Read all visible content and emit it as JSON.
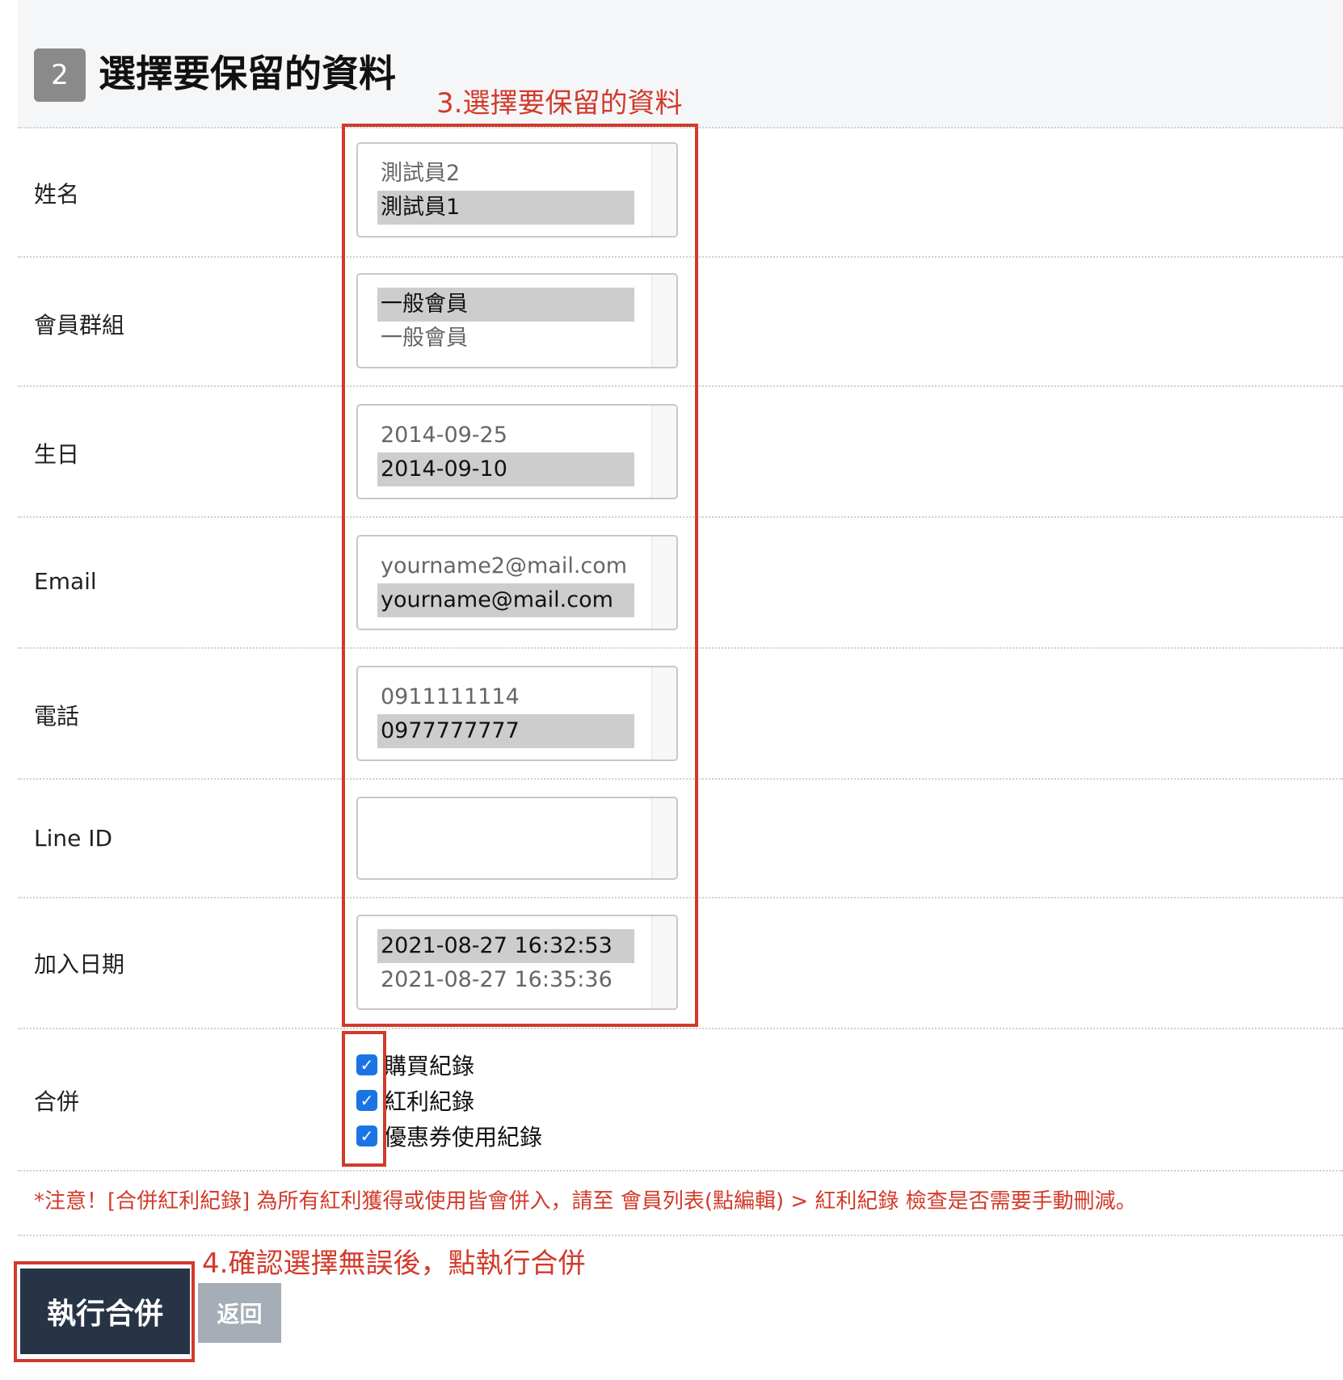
{
  "header": {
    "step_number": "2",
    "title": "選擇要保留的資料"
  },
  "annotations": {
    "step3": "3.選擇要保留的資料",
    "step4": "4.確認選擇無誤後，點執行合併"
  },
  "fields": [
    {
      "label": "姓名",
      "options": [
        {
          "text": "測試員2",
          "selected": false
        },
        {
          "text": "測試員1",
          "selected": true
        }
      ]
    },
    {
      "label": "會員群組",
      "options": [
        {
          "text": "一般會員",
          "selected": true
        },
        {
          "text": "一般會員",
          "selected": false
        }
      ]
    },
    {
      "label": "生日",
      "options": [
        {
          "text": "2014-09-25",
          "selected": false
        },
        {
          "text": "2014-09-10",
          "selected": true
        }
      ]
    },
    {
      "label": "Email",
      "options": [
        {
          "text": "yourname2@mail.com",
          "selected": false
        },
        {
          "text": "yourname@mail.com",
          "selected": true
        }
      ]
    },
    {
      "label": "電話",
      "options": [
        {
          "text": "0911111114",
          "selected": false
        },
        {
          "text": "0977777777",
          "selected": true
        }
      ]
    },
    {
      "label": "Line ID",
      "options": []
    },
    {
      "label": "加入日期",
      "options": [
        {
          "text": "2021-08-27 16:32:53",
          "selected": true
        },
        {
          "text": "2021-08-27 16:35:36",
          "selected": false
        }
      ]
    }
  ],
  "merge": {
    "label": "合併",
    "checkboxes": [
      {
        "label": "購買紀錄",
        "checked": true
      },
      {
        "label": "紅利紀錄",
        "checked": true
      },
      {
        "label": "優惠券使用紀錄",
        "checked": true
      }
    ]
  },
  "notice": "*注意！[合併紅利紀錄] 為所有紅利獲得或使用皆會併入，請至 會員列表(點編輯) > 紅利紀錄 檢查是否需要手動刪減。",
  "buttons": {
    "execute_label": "執行合併",
    "back_label": "返回"
  },
  "colors": {
    "annotation_red": "#d23a2b",
    "primary_button": "#263446",
    "secondary_button": "#a5adb6",
    "checkbox_blue": "#1b74e4"
  }
}
